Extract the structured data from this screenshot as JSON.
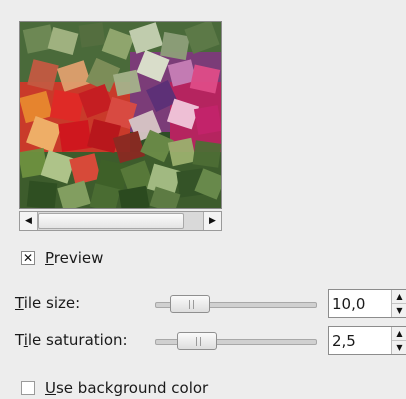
{
  "preview": {
    "checked": true,
    "label_mnemonic": "P",
    "label_rest": "review"
  },
  "scrollbar": {
    "left_arrow": "◀",
    "right_arrow": "▶"
  },
  "tile_size": {
    "label_mnemonic": "T",
    "label_rest": "ile size:",
    "value": "10,0",
    "slider_fraction": 0.12
  },
  "tile_saturation": {
    "label_prefix": "T",
    "label_mnemonic": "i",
    "label_rest": "le saturation:",
    "value": "2,5",
    "slider_fraction": 0.18
  },
  "background_color": {
    "checked": false,
    "label_mnemonic": "U",
    "label_rest": "se background color"
  },
  "spin_icons": {
    "up": "▲",
    "down": "▼"
  }
}
